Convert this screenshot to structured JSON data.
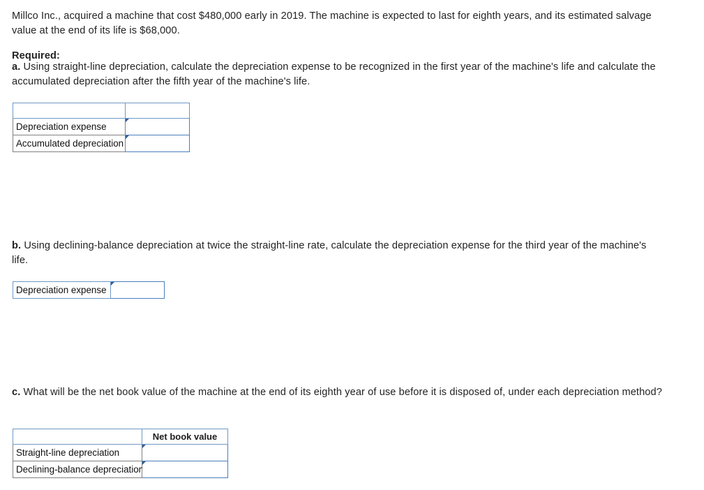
{
  "intro": {
    "text": "Millco Inc., acquired a machine that cost $480,000 early in 2019. The machine is expected to last for eighth years, and its estimated salvage value at the end of its life is $68,000."
  },
  "required_heading": "Required:",
  "questions": {
    "a": {
      "marker": "a.",
      "text": " Using straight-line depreciation, calculate the depreciation expense to be recognized in the first year of the machine's life and calculate the accumulated depreciation after the fifth year of the machine's life."
    },
    "b": {
      "marker": "b.",
      "text": " Using declining-balance depreciation at twice the straight-line rate, calculate the depreciation expense for the third year of the machine's life."
    },
    "c": {
      "marker": "c.",
      "text": " What will be the net book value of the machine at the end of its eighth year of use before it is disposed of, under each depreciation method?"
    }
  },
  "table_a": {
    "header": [
      "",
      ""
    ],
    "rows": [
      {
        "label": "Depreciation expense",
        "value": ""
      },
      {
        "label": "Accumulated depreciation",
        "value": ""
      }
    ]
  },
  "table_b": {
    "rows": [
      {
        "label": "Depreciation expense",
        "value": ""
      }
    ]
  },
  "table_c": {
    "header": [
      "",
      "Net book value"
    ],
    "rows": [
      {
        "label": "Straight-line depreciation",
        "value": ""
      },
      {
        "label": "Declining-balance depreciation",
        "value": ""
      }
    ]
  },
  "colors": {
    "header_blue": "#76a5db",
    "input_border": "#4a7ebb",
    "marker_triangle": "#2d5f9a",
    "cell_border": "#808080",
    "text": "#232323"
  }
}
